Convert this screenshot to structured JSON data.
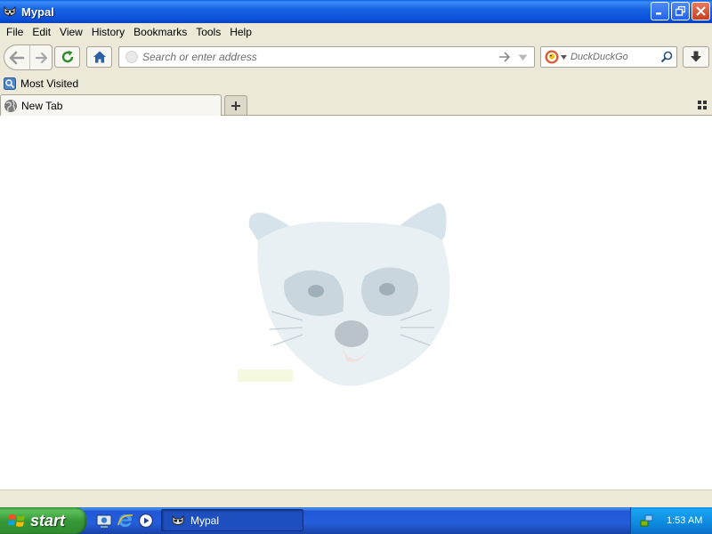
{
  "window": {
    "title": "Mypal"
  },
  "menu": [
    "File",
    "Edit",
    "View",
    "History",
    "Bookmarks",
    "Tools",
    "Help"
  ],
  "navigation": {
    "url_placeholder": "Search or enter address",
    "url_value": "",
    "search_placeholder": "DuckDuckGo",
    "search_engine_icon": "duckduckgo-icon"
  },
  "bookmarks_toolbar": {
    "items": [
      {
        "label": "Most Visited",
        "icon": "most-visited-icon"
      }
    ]
  },
  "tabs": [
    {
      "label": "New Tab",
      "icon": "globe-icon",
      "active": true
    }
  ],
  "content": {
    "mascot_icon": "raccoon-mascot-icon"
  },
  "taskbar": {
    "start_label": "start",
    "quick_launch": [
      "desktop-icon",
      "internet-explorer-icon",
      "media-player-icon"
    ],
    "tasks": [
      {
        "label": "Mypal",
        "icon": "raccoon-icon"
      }
    ],
    "clock": "1:53 AM"
  },
  "colors": {
    "titlebar_blue": "#0a4fd8",
    "chrome_beige": "#ece9d8",
    "start_green": "#379837",
    "taskbar_blue": "#245edb",
    "tray_blue": "#0d8ae0"
  }
}
